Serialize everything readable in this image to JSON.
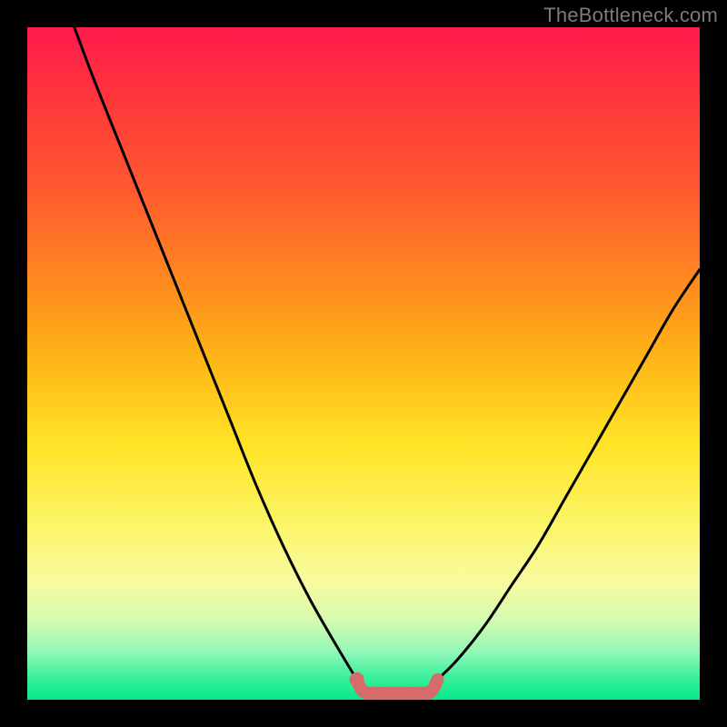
{
  "watermark": "TheBottleneck.com",
  "colors": {
    "curve_stroke": "#000000",
    "marker_stroke": "#d76a6a",
    "marker_fill": "#d76a6a",
    "frame_bg": "#000000"
  },
  "chart_data": {
    "type": "line",
    "title": "",
    "xlabel": "",
    "ylabel": "",
    "xlim": [
      0,
      100
    ],
    "ylim": [
      0,
      100
    ],
    "grid": false,
    "series": [
      {
        "name": "left-curve",
        "x": [
          7,
          10,
          14,
          18,
          22,
          26,
          30,
          34,
          38,
          42,
          46,
          49
        ],
        "y": [
          100,
          92,
          82,
          72,
          62,
          52,
          42,
          32,
          23,
          15,
          8,
          3
        ]
      },
      {
        "name": "right-curve",
        "x": [
          61,
          64,
          68,
          72,
          76,
          80,
          84,
          88,
          92,
          96,
          100
        ],
        "y": [
          3,
          6,
          11,
          17,
          23,
          30,
          37,
          44,
          51,
          58,
          64
        ]
      },
      {
        "name": "bottom-marker",
        "x": [
          49,
          50,
          52,
          55,
          58,
          60,
          61
        ],
        "y": [
          3,
          1.2,
          1,
          1,
          1,
          1.2,
          3
        ]
      }
    ],
    "annotations": [
      {
        "name": "marker-dot",
        "x": 49,
        "y": 3
      }
    ]
  }
}
